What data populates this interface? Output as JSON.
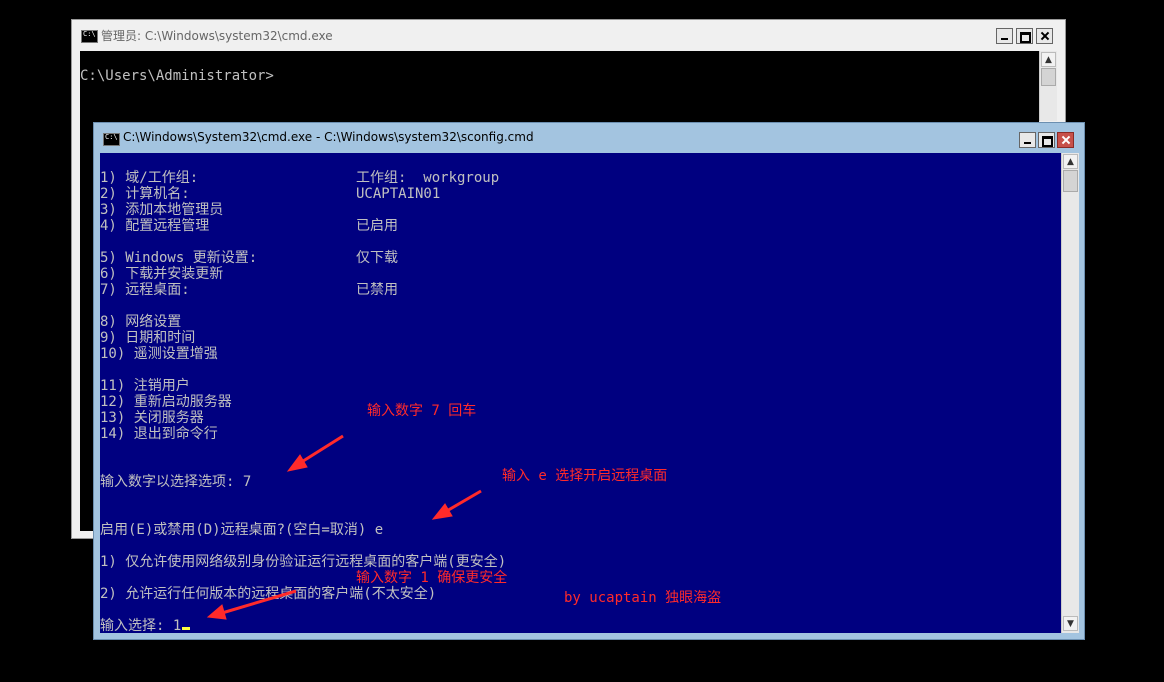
{
  "bg_window": {
    "title": "管理员: C:\\Windows\\system32\\cmd.exe",
    "prompt": "C:\\Users\\Administrator>"
  },
  "fg_window": {
    "title": "C:\\Windows\\System32\\cmd.exe - C:\\Windows\\system32\\sconfig.cmd",
    "menu": [
      {
        "label": "1) 域/工作组:",
        "value": "工作组:  workgroup"
      },
      {
        "label": "2) 计算机名:",
        "value": "UCAPTAIN01"
      },
      {
        "label": "3) 添加本地管理员",
        "value": ""
      },
      {
        "label": "4) 配置远程管理",
        "value": "已启用"
      },
      {
        "label": "5) Windows 更新设置:",
        "value": "仅下载"
      },
      {
        "label": "6) 下载并安装更新",
        "value": ""
      },
      {
        "label": "7) 远程桌面:",
        "value": "已禁用"
      },
      {
        "label": "8) 网络设置",
        "value": ""
      },
      {
        "label": "9) 日期和时间",
        "value": ""
      },
      {
        "label": "10) 遥测设置增强",
        "value": ""
      },
      {
        "label": "11) 注销用户",
        "value": ""
      },
      {
        "label": "12) 重新启动服务器",
        "value": ""
      },
      {
        "label": "13) 关闭服务器",
        "value": ""
      },
      {
        "label": "14) 退出到命令行",
        "value": ""
      }
    ],
    "select_prompt": "输入数字以选择选项: 7",
    "enable_prompt": "启用(E)或禁用(D)远程桌面?(空白=取消) e",
    "option1": "1) 仅允许使用网络级别身份验证运行远程桌面的客户端(更安全)",
    "option2": "2) 允许运行任何版本的远程桌面的客户端(不太安全)",
    "input_prompt": "输入选择: 1"
  },
  "annotations": {
    "a1": "输入数字 7 回车",
    "a2": "输入 e 选择开启远程桌面",
    "a3": "输入数字 1 确保更安全",
    "credit": "by ucaptain 独眼海盗"
  },
  "colors": {
    "console_blue": "#000080",
    "annotation_red": "#ff2a2a",
    "title_active": "#a3c4e0"
  }
}
